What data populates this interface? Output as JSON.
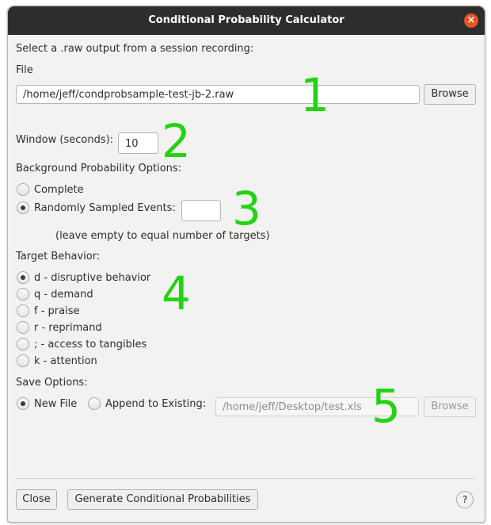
{
  "window": {
    "title": "Conditional Probability Calculator"
  },
  "file_section": {
    "instruction": "Select a .raw output from a session recording:",
    "file_label": "File",
    "file_value": "/home/jeff/condprobsample-test-jb-2.raw",
    "browse_label": "Browse"
  },
  "window_field": {
    "label": "Window (seconds):",
    "value": "10"
  },
  "background": {
    "heading": "Background Probability Options:",
    "complete_label": "Complete",
    "random_label": "Randomly Sampled Events:",
    "random_value": "",
    "hint": "(leave empty to equal number of targets)",
    "selected": "random"
  },
  "target": {
    "heading": "Target Behavior:",
    "options": [
      {
        "label": "d - disruptive behavior",
        "selected": true
      },
      {
        "label": "q - demand",
        "selected": false
      },
      {
        "label": "f - praise",
        "selected": false
      },
      {
        "label": "r - reprimand",
        "selected": false
      },
      {
        "label": "; - access to tangibles",
        "selected": false
      },
      {
        "label": "k - attention",
        "selected": false
      }
    ]
  },
  "save": {
    "heading": "Save Options:",
    "new_file_label": "New File",
    "append_label": "Append to Existing:",
    "path_value": "/home/jeff/Desktop/test.xls",
    "browse_label": "Browse",
    "selected": "new"
  },
  "footer": {
    "close_label": "Close",
    "generate_label": "Generate Conditional Probabilities",
    "help_label": "?"
  },
  "annotations": [
    "1",
    "2",
    "3",
    "4",
    "5"
  ],
  "colors": {
    "annotation": "#22d311",
    "titlebar": "#2d2d2d",
    "close_button": "#e95420"
  },
  "icons": {
    "close": "close-icon",
    "help": "help-icon"
  }
}
